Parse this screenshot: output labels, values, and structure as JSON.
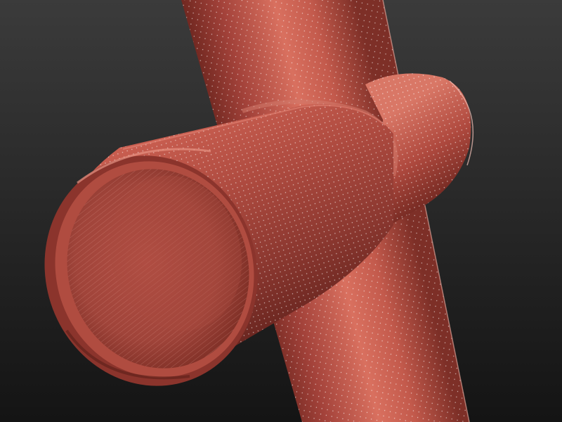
{
  "scene": {
    "background_top": "#3b3b3b",
    "background_bottom": "#141414",
    "tube_color": "#a8453b",
    "tube_highlight": "#e07b6c",
    "tube_shadow": "#5a1f1a",
    "wire_color": "#ffffff",
    "objects": [
      {
        "name": "vertical-tube-icon"
      },
      {
        "name": "horizontal-tube-icon"
      },
      {
        "name": "open-tube-end-icon"
      }
    ]
  }
}
